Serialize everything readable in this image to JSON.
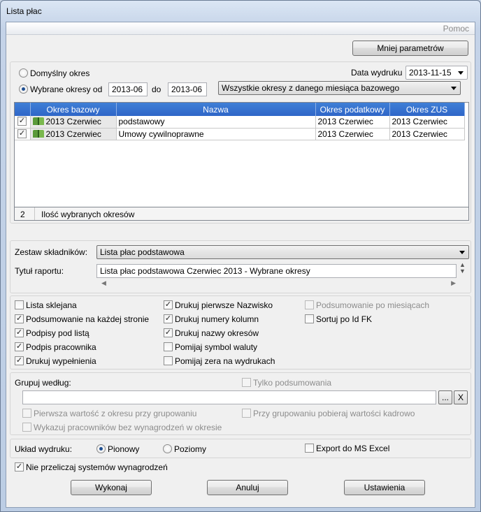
{
  "window": {
    "title": "Lista płac",
    "help": "Pomoc"
  },
  "params_button": "Mniej parametrów",
  "period": {
    "default_label": "Domyślny  okres",
    "selected_label": "Wybrane okresy od",
    "from": "2013-06",
    "to_label": "do",
    "to": "2013-06",
    "print_date_label": "Data wydruku",
    "print_date": "2013-11-15",
    "scope": "Wszystkie okresy z danego miesiąca bazowego"
  },
  "grid": {
    "columns": [
      "Okres bazowy",
      "Nazwa",
      "Okres podatkowy",
      "Okres ZUS"
    ],
    "rows": [
      {
        "base": "2013 Czerwiec",
        "name": "podstawowy",
        "tax": "2013 Czerwiec",
        "zus": "2013 Czerwiec"
      },
      {
        "base": "2013 Czerwiec",
        "name": "Umowy cywilnoprawne",
        "tax": "2013 Czerwiec",
        "zus": "2013 Czerwiec"
      }
    ],
    "count": "2",
    "count_label": "Ilość wybranych okresów"
  },
  "components": {
    "label": "Zestaw składników:",
    "value": "Lista płac podstawowa"
  },
  "report_title": {
    "label": "Tytuł raportu:",
    "value": "Lista płac podstawowa Czerwiec 2013 - Wybrane okresy"
  },
  "options": {
    "col1": [
      "Lista sklejana",
      "Podsumowanie na każdej stronie",
      "Podpisy pod listą",
      "Podpis pracownika",
      "Drukuj wypełnienia"
    ],
    "col2": [
      "Drukuj pierwsze Nazwisko",
      "Drukuj numery kolumn",
      "Drukuj nazwy okresów",
      "Pomijaj symbol waluty",
      "Pomijaj zera na wydrukach"
    ],
    "col3": [
      "Podsumowanie po miesiącach",
      "Sortuj po Id FK"
    ]
  },
  "grouping": {
    "label": "Grupuj według:",
    "summary_only": "Tylko podsumowania",
    "first_value": "Pierwsza wartość z okresu przy grupowaniu",
    "hr_values": "Przy grupowaniu pobieraj wartości kadrowo",
    "no_pay": "Wykazuj pracowników bez wynagrodzeń w okresie",
    "browse": "...",
    "clear": "X"
  },
  "layout": {
    "label": "Układ wydruku:",
    "portrait": "Pionowy",
    "landscape": "Poziomy",
    "excel": "Export do MS Excel"
  },
  "no_recalc": "Nie przeliczaj systemów wynagrodzeń",
  "actions": {
    "run": "Wykonaj",
    "cancel": "Anuluj",
    "settings": "Ustawienia"
  }
}
